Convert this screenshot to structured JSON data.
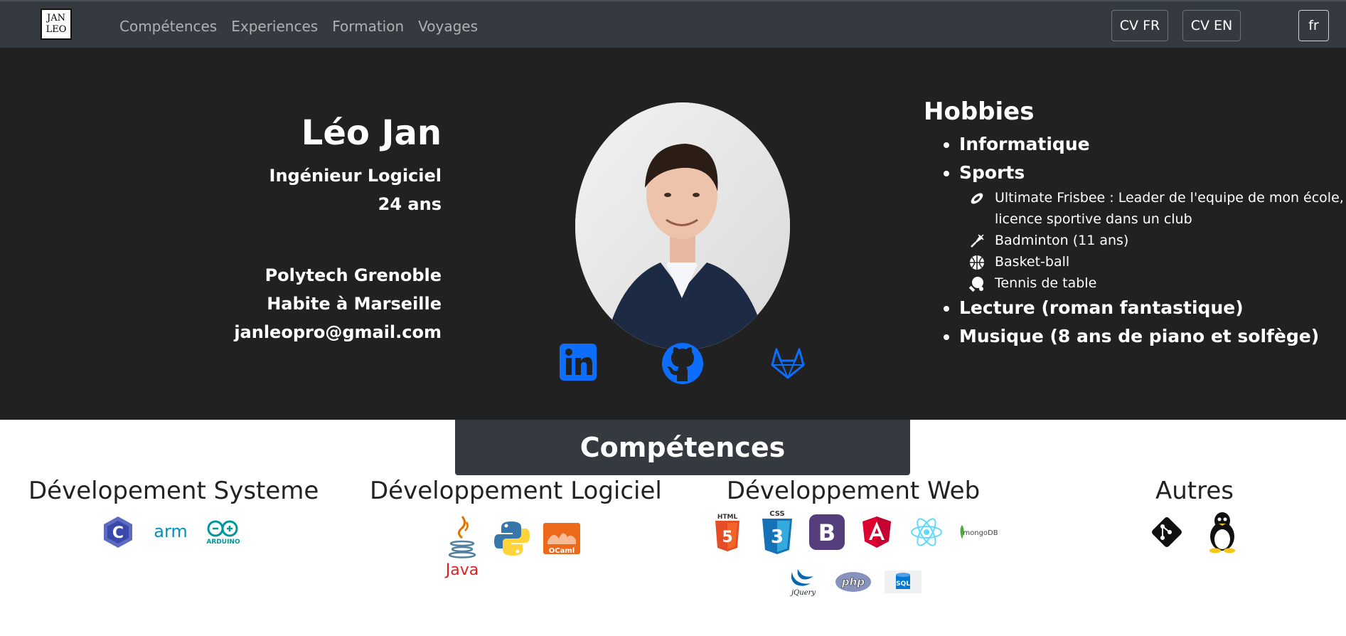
{
  "navbar": {
    "logo_text": "JAN LEO",
    "links": [
      "Compétences",
      "Experiences",
      "Formation",
      "Voyages"
    ],
    "cv_fr": "CV FR",
    "cv_en": "CV EN",
    "lang": "fr"
  },
  "profile": {
    "name": "Léo Jan",
    "title": "Ingénieur Logiciel",
    "age": "24 ans",
    "school": "Polytech Grenoble",
    "location": "Habite à Marseille",
    "email": "janleopro@gmail.com"
  },
  "socials": [
    "linkedin-icon",
    "github-icon",
    "gitlab-icon"
  ],
  "hobbies": {
    "title": "Hobbies",
    "items": {
      "informatique": "Informatique",
      "sports": "Sports",
      "lecture": "Lecture (roman fantastique)",
      "musique": "Musique (8 ans de piano et solfège)"
    },
    "sports": [
      {
        "icon": "frisbee-icon",
        "label": "Ultimate Frisbee : Leader de l'equipe de mon école, licence sportive dans un club"
      },
      {
        "icon": "badminton-icon",
        "label": "Badminton (11 ans)"
      },
      {
        "icon": "basketball-icon",
        "label": "Basket-ball"
      },
      {
        "icon": "table-tennis-icon",
        "label": "Tennis de table"
      }
    ]
  },
  "skills": {
    "title": "Compétences",
    "categories": [
      {
        "title": "Dévelopement Systeme",
        "icons": [
          "c-logo",
          "arm-logo",
          "arduino-logo"
        ]
      },
      {
        "title": "Développement Logiciel",
        "icons": [
          "java-logo",
          "python-logo",
          "ocaml-logo"
        ]
      },
      {
        "title": "Développement Web",
        "icons": [
          "html5-logo",
          "css3-logo",
          "bootstrap-logo",
          "angular-logo",
          "react-logo",
          "mongodb-logo",
          "jquery-logo",
          "php-logo",
          "sql-logo"
        ]
      },
      {
        "title": "Autres",
        "icons": [
          "git-logo",
          "linux-logo"
        ]
      }
    ],
    "logo_texts": {
      "arm": "arm",
      "arduino": "ARDUINO",
      "java": "Java",
      "ocaml": "OCaml",
      "html": "HTML",
      "css": "CSS",
      "mongodb": "mongoDB",
      "jquery": "jQuery",
      "php": "php",
      "sql": "SQL"
    }
  },
  "colors": {
    "navbar": "#343a40",
    "hero": "#212121",
    "social_blue": "#0d6efd"
  }
}
